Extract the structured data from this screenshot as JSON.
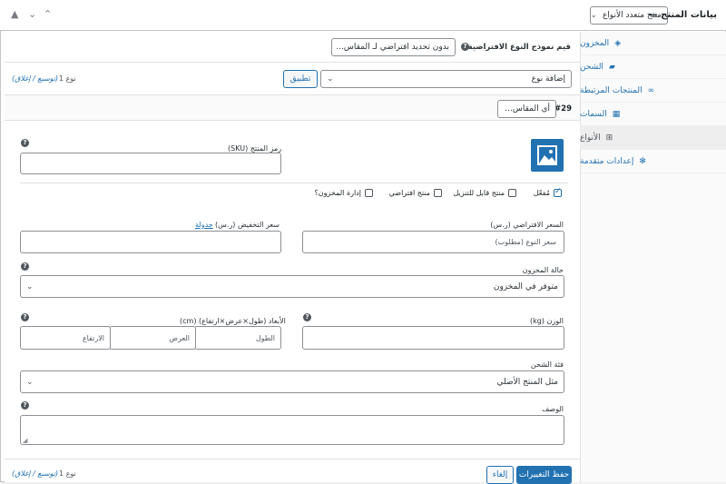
{
  "header": {
    "title": "بيانات المنتج —",
    "product_type": "منتج متعدد الأنواع"
  },
  "defaults": {
    "label": "قيم نموذج النوع الافتراضية:",
    "select": "بدون تحديد افتراضي لـ المقاس..."
  },
  "toolbar_top": {
    "add_variation": "إضافة نوع",
    "apply": "تطبيق",
    "count": "نوع 1",
    "expand_collapse": "(توسيع / إغلاق)"
  },
  "variation": {
    "number": "#29",
    "size_select": "أي المقاس...",
    "sku_label": "رمز المنتج (SKU)",
    "checkboxes": {
      "enabled": "مُفعّل",
      "downloadable": "منتج قابل للتنزيل",
      "virtual": "منتج افتراضي",
      "manage_stock": "إدارة المخزون؟"
    },
    "regular_price_label": "السعر الافتراضي (ر.س)",
    "regular_price_placeholder": "سعر النوع (مطلوب)",
    "sale_price_label": "سعر التخفيض (ر.س)",
    "schedule_link": "جدولة",
    "stock_status_label": "حالة المخزون",
    "stock_status_value": "متوفر في المخزون",
    "weight_label": "الوزن (kg)",
    "dimensions_label": "الأبعاد (طول×عرض×ارتفاع) (cm)",
    "length_ph": "الطول",
    "width_ph": "العرض",
    "height_ph": "الارتفاع",
    "shipping_class_label": "فئة الشحن",
    "shipping_class_value": "مثل المنتج الأصلي",
    "description_label": "الوصف"
  },
  "footer": {
    "save": "حفظ التغييرات",
    "cancel": "إلغاء",
    "count": "نوع 1",
    "expand_collapse": "(توسيع / إغلاق)"
  },
  "tabs": [
    {
      "label": "المخزون",
      "icon": "inventory-icon"
    },
    {
      "label": "الشحن",
      "icon": "truck-icon"
    },
    {
      "label": "المنتجات المرتبطة",
      "icon": "link-icon"
    },
    {
      "label": "السمات",
      "icon": "table-icon"
    },
    {
      "label": "الأنواع",
      "icon": "grid-icon"
    },
    {
      "label": "إعدادات متقدمة",
      "icon": "gear-icon"
    }
  ],
  "colors": {
    "accent": "#2271b1",
    "active_tab": "#eeeeee"
  }
}
